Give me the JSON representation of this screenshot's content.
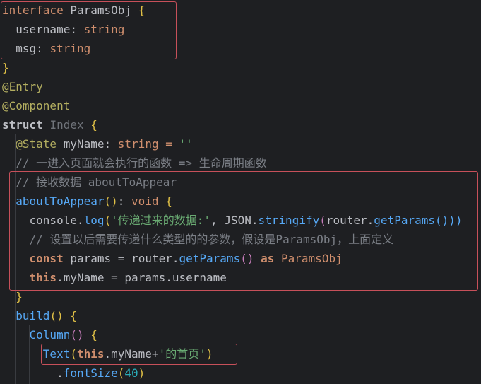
{
  "code": {
    "l1": {
      "kw": "interface",
      "name": "ParamsObj",
      "brace": "{"
    },
    "l2": {
      "prop": "username",
      "colon": ":",
      "type": "string"
    },
    "l3": {
      "prop": "msg",
      "colon": ":",
      "type": "string"
    },
    "l4": {
      "brace": "}"
    },
    "l5": {
      "deco": "@Entry"
    },
    "l6": {
      "deco": "@Component"
    },
    "l7": {
      "kw": "struct",
      "name": "Index",
      "brace": "{"
    },
    "l8": {
      "deco": "@State",
      "name": "myName",
      "colon": ":",
      "type": "string",
      "eq": "=",
      "val": "''"
    },
    "l9": {
      "text": "// 一进入页面就会执行的函数 => 生命周期函数"
    },
    "l10": {
      "text": "// 接收数据 aboutToAppear"
    },
    "l11": {
      "fn": "aboutToAppear",
      "parens": "()",
      "colon": ":",
      "type": "void",
      "brace": "{"
    },
    "l12": {
      "obj": "console",
      "dot": ".",
      "fn": "log",
      "open": "(",
      "str": "'传递过来的数据:'",
      "comma": ",",
      "json": "JSON",
      "dot2": ".",
      "fn2": "stringify",
      "open2": "(",
      "router": "router",
      "dot3": ".",
      "fn3": "getParams",
      "close": "()))"
    },
    "l13": {
      "text": "// 设置以后需要传递什么类型的的参数，假设是ParamsObj，上面定义"
    },
    "l14": {
      "kw": "const",
      "name": "params",
      "eq": "=",
      "router": "router",
      "dot": ".",
      "fn": "getParams",
      "parens": "()",
      "as": "as",
      "type": "ParamsObj"
    },
    "l15": {
      "this": "this",
      "dot": ".",
      "field": "myName",
      "eq": "=",
      "rhs": "params.username"
    },
    "l16": {
      "brace": "}"
    },
    "l17": {
      "fn": "build",
      "parens": "()",
      "brace": "{"
    },
    "l18": {
      "fn": "Column",
      "parens": "()",
      "brace": "{"
    },
    "l19": {
      "fn": "Text",
      "open": "(",
      "this": "this",
      "dot": ".",
      "field": "myName",
      "plus": "+",
      "str": "'的首页'",
      "close": ")"
    },
    "l20": {
      "dot": ".",
      "fn": "fontSize",
      "open": "(",
      "num": "40",
      "close": ")"
    }
  }
}
